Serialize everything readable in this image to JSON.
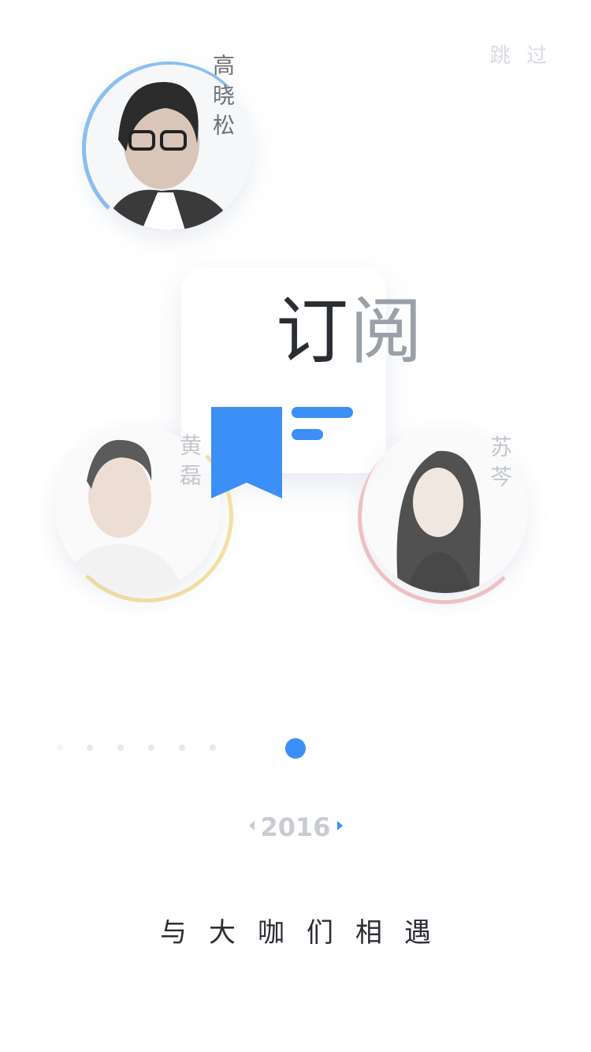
{
  "header": {
    "skip_label": "跳 过"
  },
  "people": [
    {
      "name": "高晓松",
      "ring_color": "#8cc2f5",
      "name_color": "#6d7278"
    },
    {
      "name": "黄磊",
      "ring_color": "#f8e2a2",
      "name_color": "#c3c7cd"
    },
    {
      "name": "苏芩",
      "ring_color": "#f6c4c4",
      "name_color": "#c3c7cd"
    }
  ],
  "feature": {
    "title_main": "订",
    "title_part": "阅",
    "accent_color": "#3b8ff7"
  },
  "pager": {
    "total": 8,
    "current": 8
  },
  "timeline": {
    "year": "2016"
  },
  "tagline": "与大咖们相遇"
}
